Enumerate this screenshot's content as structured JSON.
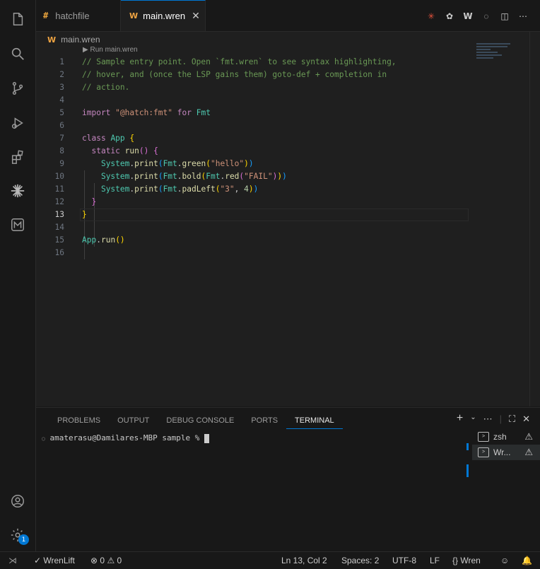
{
  "tabs": [
    {
      "label": "hatchfile"
    },
    {
      "label": "main.wren"
    }
  ],
  "breadcrumb": "main.wren",
  "codelens": "▶ Run main.wren",
  "editor": {
    "line_numbers": [
      "1",
      "2",
      "3",
      "4",
      "5",
      "6",
      "7",
      "8",
      "9",
      "10",
      "11",
      "12",
      "13",
      "14",
      "15",
      "16"
    ],
    "current_line": 13
  },
  "panel": {
    "tabs": [
      "PROBLEMS",
      "OUTPUT",
      "DEBUG CONSOLE",
      "PORTS",
      "TERMINAL"
    ],
    "active_tab": "TERMINAL",
    "prompt": "amaterasu@Damilares-MBP sample % ",
    "terminals": [
      {
        "label": "zsh"
      },
      {
        "label": "Wr..."
      }
    ]
  },
  "status": {
    "remote": "WrenLift",
    "errors": "0",
    "warnings": "0",
    "position": "Ln 13, Col 2",
    "spaces": "Spaces: 2",
    "encoding": "UTF-8",
    "eol": "LF",
    "language": "Wren"
  },
  "badge": "1"
}
